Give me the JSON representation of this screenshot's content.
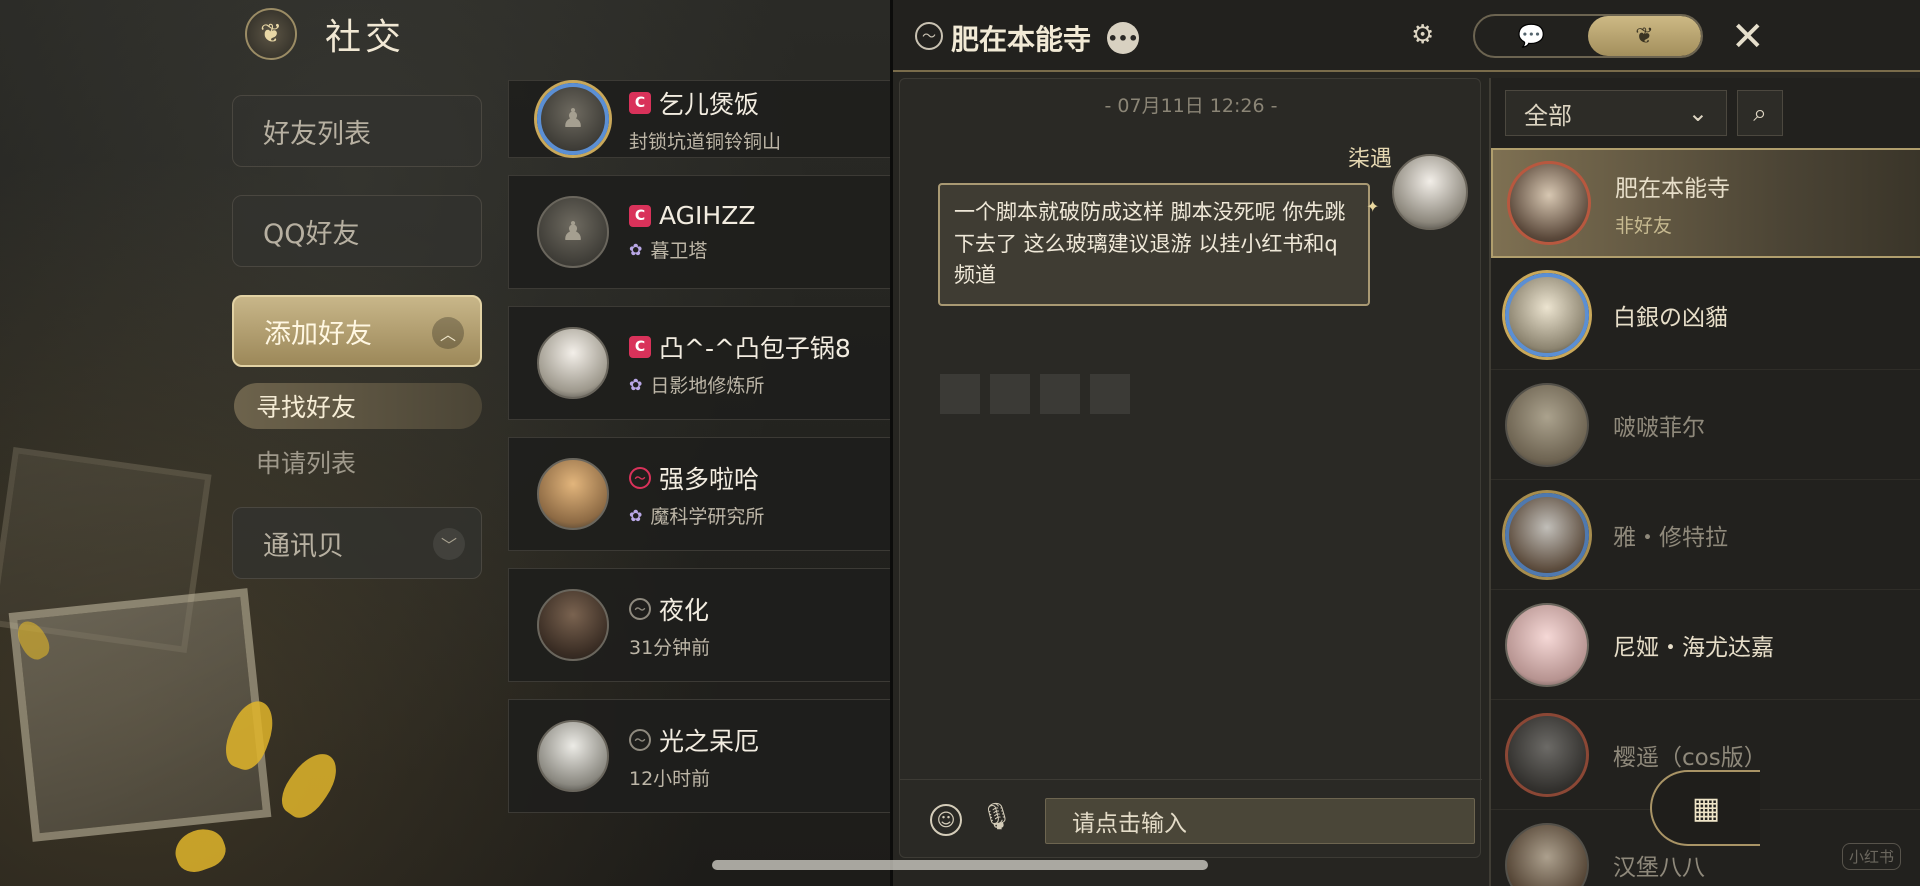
{
  "header": {
    "title": "社交",
    "emblem_icon": "moogle-emblem-icon"
  },
  "nav": {
    "friend_list": "好友列表",
    "qq_friends": "QQ好友",
    "add_friend": "添加好友",
    "find_friend": "寻找好友",
    "request_list": "申请列表",
    "contacts": "通讯贝"
  },
  "friends": [
    {
      "name": "乞儿煲饭",
      "sub": "封锁坑道铜铃铜山",
      "status": "online",
      "sub_type": "location"
    },
    {
      "name": "AGIHZZ",
      "sub": "暮卫塔",
      "status": "online",
      "sub_type": "world"
    },
    {
      "name": "凸^-^凸包子锅8",
      "sub": "日影地修炼所",
      "status": "online",
      "sub_type": "world"
    },
    {
      "name": "强多啦哈",
      "sub": "魔科学研究所",
      "status": "away",
      "sub_type": "world"
    },
    {
      "name": "夜化",
      "sub": "31分钟前",
      "status": "offline",
      "sub_type": "time"
    },
    {
      "name": "光之呆厄",
      "sub": "12小时前",
      "status": "offline",
      "sub_type": "time"
    }
  ],
  "chat": {
    "target_name": "肥在本能寺",
    "timestamp": "- 07月11日 12:26 -",
    "sender": "柒遇",
    "message": "一个脚本就破防成这样 脚本没死呢 你先跳下去了 这么玻璃建议退游 以挂小红书和q频道",
    "input_placeholder": "请点击输入"
  },
  "contacts": {
    "filter": "全部",
    "items": [
      {
        "name": "肥在本能寺",
        "sub": "非好友",
        "active": true,
        "dim": false
      },
      {
        "name": "白銀の凶貓",
        "sub": "",
        "active": false,
        "dim": false
      },
      {
        "name": "啵啵菲尔",
        "sub": "",
        "active": false,
        "dim": true
      },
      {
        "name": "雅・修特拉",
        "sub": "",
        "active": false,
        "dim": true
      },
      {
        "name": "尼娅・海尤达嘉",
        "sub": "",
        "active": false,
        "dim": false
      },
      {
        "name": "樱遥（cos版）",
        "sub": "",
        "active": false,
        "dim": true
      },
      {
        "name": "汉堡八八",
        "sub": "",
        "active": false,
        "dim": true
      }
    ]
  },
  "watermark": "小红书",
  "colors": {
    "accent_gold": "#c8b689",
    "online_red": "#d9325a",
    "world_purple": "#b9a7e6"
  }
}
